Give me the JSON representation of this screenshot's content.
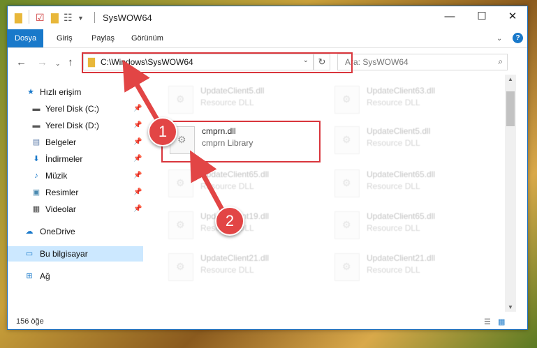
{
  "window": {
    "title": "SysWOW64",
    "minimize_icon": "minimize-icon",
    "maximize_icon": "maximize-icon",
    "close_icon": "close-icon"
  },
  "ribbon": {
    "tabs": [
      "Dosya",
      "Giriş",
      "Paylaş",
      "Görünüm"
    ],
    "active_tab": "Dosya",
    "accent": "#1979ca"
  },
  "nav": {
    "address": "C:\\Windows\\SysWOW64",
    "search_placeholder": "Ara: SysWOW64"
  },
  "sidebar": {
    "items": [
      {
        "label": "Hızlı erişim",
        "icon": "star-icon"
      },
      {
        "label": "Yerel Disk (C:)",
        "icon": "drive-icon",
        "pinned": true
      },
      {
        "label": "Yerel Disk (D:)",
        "icon": "drive-icon",
        "pinned": true
      },
      {
        "label": "Belgeler",
        "icon": "document-icon",
        "pinned": true
      },
      {
        "label": "İndirmeler",
        "icon": "download-icon",
        "pinned": true
      },
      {
        "label": "Müzik",
        "icon": "music-icon",
        "pinned": true
      },
      {
        "label": "Resimler",
        "icon": "picture-icon",
        "pinned": true
      },
      {
        "label": "Videolar",
        "icon": "video-icon",
        "pinned": true
      },
      {
        "label": "OneDrive",
        "icon": "cloud-icon"
      },
      {
        "label": "Bu bilgisayar",
        "icon": "computer-icon",
        "selected": true
      },
      {
        "label": "Ağ",
        "icon": "network-icon"
      }
    ]
  },
  "files": {
    "highlighted": {
      "name": "cmprn.dll",
      "type": "cmprn Library"
    },
    "background": [
      {
        "name": "UpdateClient5.dll",
        "type": "Resource DLL"
      },
      {
        "name": "UpdateClient63.dll",
        "type": "Resource DLL"
      },
      {
        "name": "UpdateClient5.dll",
        "type": "Resource DLL"
      },
      {
        "name": "UpdateClient65.dll",
        "type": "Resource DLL"
      },
      {
        "name": "UpdateClient65.dll",
        "type": "Resource DLL"
      },
      {
        "name": "UpdateClient19.dll",
        "type": "Resource DLL"
      },
      {
        "name": "UpdateClient65.dll",
        "type": "Resource DLL"
      },
      {
        "name": "UpdateClient21.dll",
        "type": "Resource DLL"
      },
      {
        "name": "UpdateClient21.dll",
        "type": "Resource DLL"
      }
    ]
  },
  "status": {
    "count": "156 öğe"
  },
  "callouts": {
    "one": "1",
    "two": "2",
    "color": "#e24545"
  }
}
